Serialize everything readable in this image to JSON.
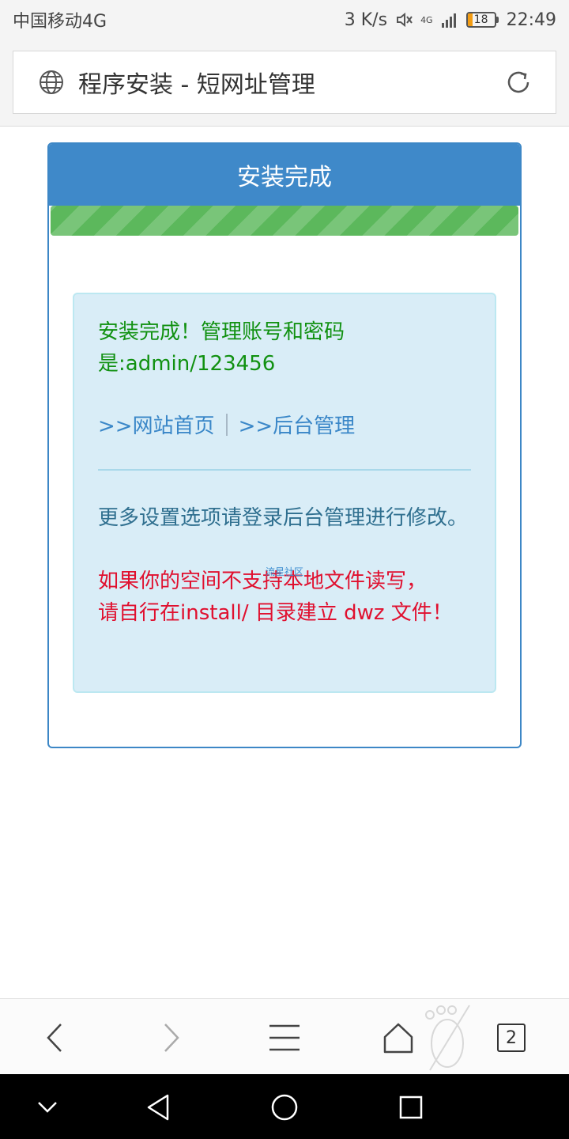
{
  "status_bar": {
    "carrier": "中国移动4G",
    "speed": "3 K/s",
    "network": "4G",
    "battery_level": "18",
    "battery_fraction": 0.18,
    "time": "22:49"
  },
  "address_bar": {
    "title": "程序安装 - 短网址管理",
    "icons": [
      "globe-icon",
      "reload-icon"
    ]
  },
  "panel": {
    "heading": "安装完成",
    "progress_percent": 100,
    "colors": {
      "header": "#3f89c9",
      "progress": "#5cb85c"
    }
  },
  "alert": {
    "success_line1": "安装完成！管理账号和密码",
    "success_line2": "是:admin/123456",
    "link_home": ">>网站首页",
    "link_admin": ">>后台管理",
    "info": "更多设置选项请登录后台管理进行修改。",
    "watermark": "流星社区",
    "warning_line1": "如果你的空间不支持本地文件读写，",
    "warning_line2": "请自行在install/ 目录建立 dwz 文件！",
    "colors": {
      "success": "#119111",
      "link": "#3a87c8",
      "info": "#2f6f8f",
      "warning": "#e0102f"
    }
  },
  "toolbar": {
    "tab_count": "2",
    "icons": [
      "back-icon",
      "forward-icon",
      "menu-icon",
      "home-icon",
      "tabs-icon"
    ]
  },
  "navbar": {
    "icons": [
      "collapse-icon",
      "back-triangle-icon",
      "home-circle-icon",
      "recents-square-icon"
    ]
  }
}
